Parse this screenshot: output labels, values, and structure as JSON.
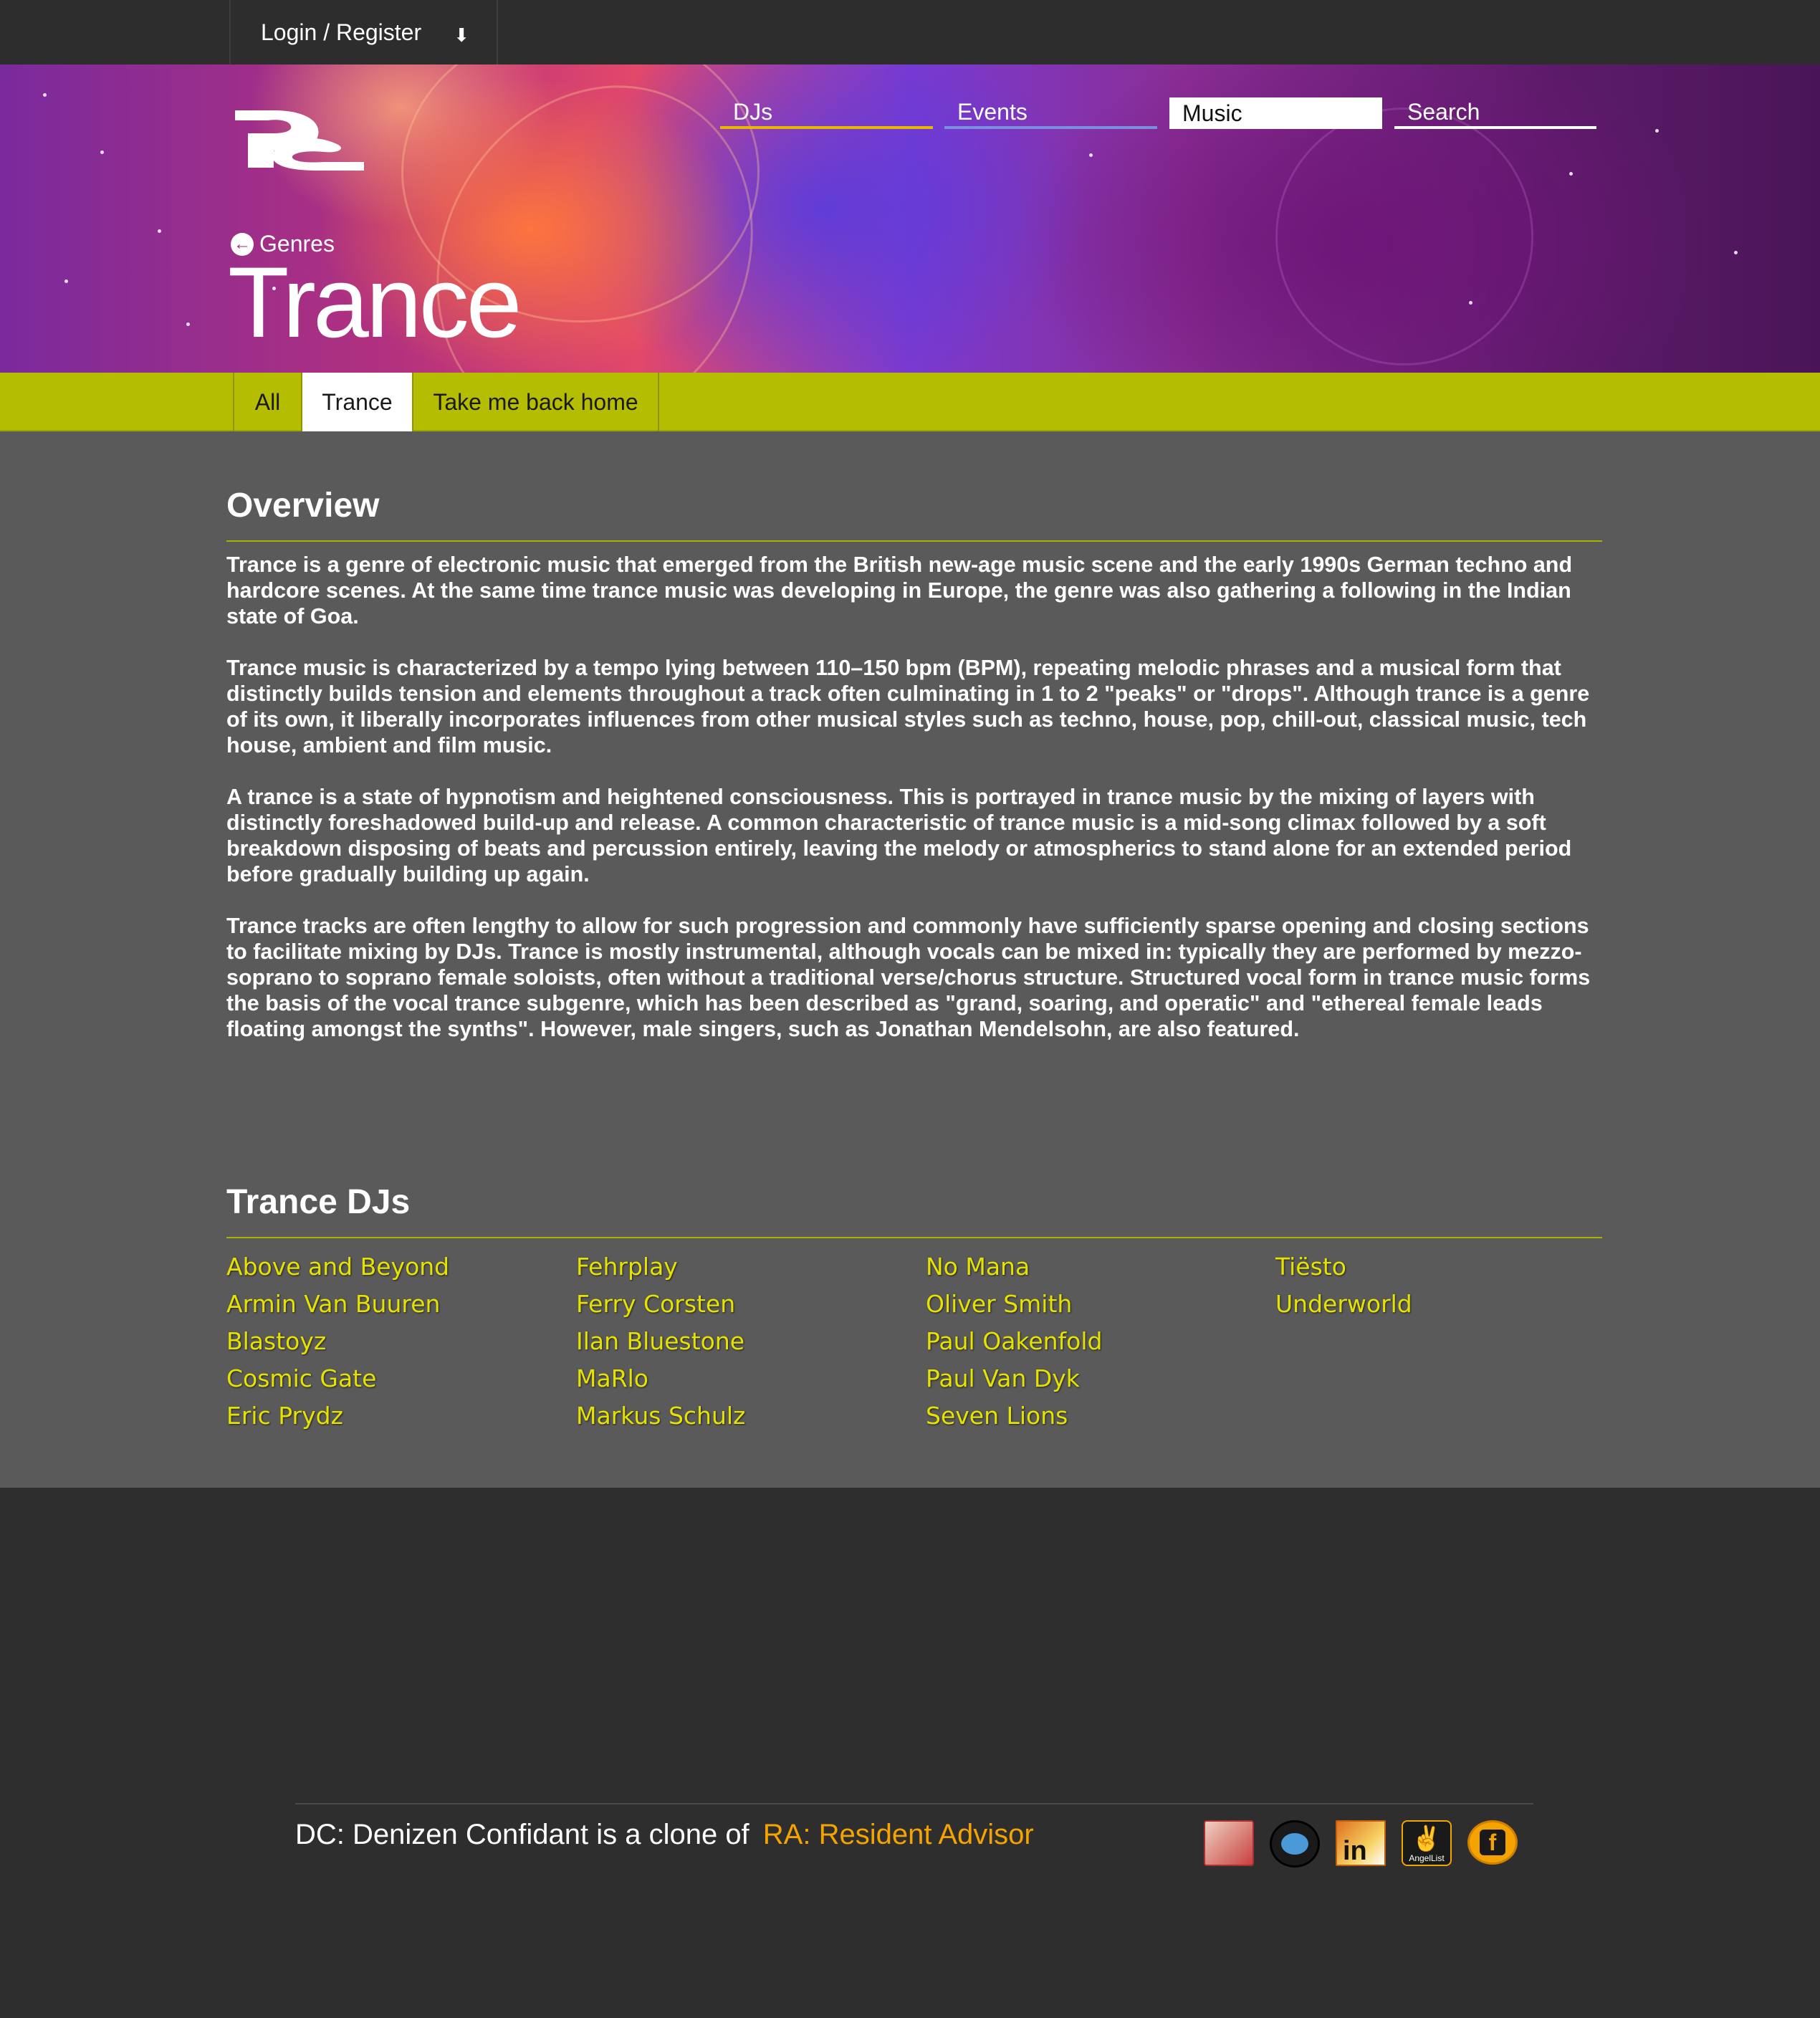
{
  "topbar": {
    "login_label": "Login / Register",
    "arrow": "⬇"
  },
  "nav": {
    "djs": "DJs",
    "events": "Events",
    "music": "Music",
    "search": "Search"
  },
  "header": {
    "back_label": "Genres",
    "title": "Trance"
  },
  "tabs": {
    "all": "All",
    "trance": "Trance",
    "home": "Take me back home"
  },
  "overview": {
    "title": "Overview",
    "paragraphs": [
      "Trance is a genre of electronic music that emerged from the British new-age music scene and the early 1990s German techno and hardcore scenes. At the same time trance music was developing in Europe, the genre was also gathering a following in the Indian state of Goa.",
      "Trance music is characterized by a tempo lying between 110–150 bpm (BPM), repeating melodic phrases and a musical form that distinctly builds tension and elements throughout a track often culminating in 1 to 2 \"peaks\" or \"drops\". Although trance is a genre of its own, it liberally incorporates influences from other musical styles such as techno, house, pop, chill-out, classical music, tech house, ambient and film music.",
      "A trance is a state of hypnotism and heightened consciousness. This is portrayed in trance music by the mixing of layers with distinctly foreshadowed build-up and release. A common characteristic of trance music is a mid-song climax followed by a soft breakdown disposing of beats and percussion entirely, leaving the melody or atmospherics to stand alone for an extended period before gradually building up again.",
      "Trance tracks are often lengthy to allow for such progression and commonly have sufficiently sparse opening and closing sections to facilitate mixing by DJs. Trance is mostly instrumental, although vocals can be mixed in: typically they are performed by mezzo-soprano to soprano female soloists, often without a traditional verse/chorus structure. Structured vocal form in trance music forms the basis of the vocal trance subgenre, which has been described as \"grand, soaring, and operatic\" and \"ethereal female leads floating amongst the synths\". However, male singers, such as Jonathan Mendelsohn, are also featured."
    ]
  },
  "djs": {
    "title": "Trance DJs",
    "columns": [
      [
        "Above and Beyond",
        "Armin Van Buuren",
        "Blastoyz",
        "Cosmic Gate",
        "Eric Prydz"
      ],
      [
        "Fehrplay",
        "Ferry Corsten",
        "Ilan Bluestone",
        "MaRlo",
        "Markus Schulz"
      ],
      [
        "No Mana",
        "Oliver Smith",
        "Paul Oakenfold",
        "Paul Van Dyk",
        "Seven Lions"
      ],
      [
        "Tiësto",
        "Underworld"
      ]
    ]
  },
  "footer": {
    "text": "DC: Denizen Confidant is a clone of",
    "link": "RA: Resident Advisor",
    "social": [
      "portfolio-icon",
      "github-icon",
      "linkedin-icon",
      "angellist-icon",
      "facebook-icon"
    ],
    "angellist_label": "AngelList",
    "linkedin_label": "in",
    "facebook_label": "f"
  },
  "colors": {
    "accent": "#b5bd00",
    "dj_link": "#e6e200",
    "footer_link": "#f4a300",
    "main_bg": "#5a5a5a",
    "dark_bg": "#2e2e2e"
  }
}
